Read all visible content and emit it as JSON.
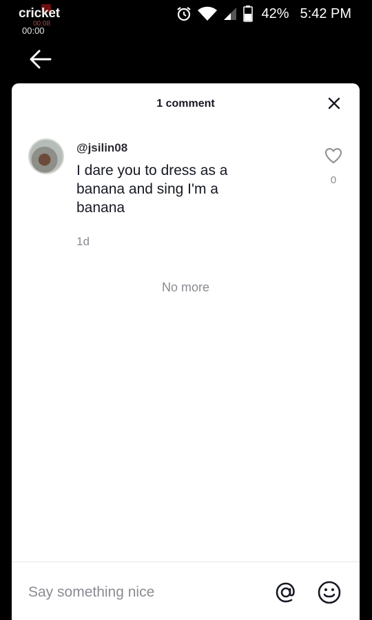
{
  "status_bar": {
    "carrier": "cricket",
    "rec_time": "00:00",
    "rec_time_sub": "00:08",
    "battery_percent": "42%",
    "clock": "5:42 PM",
    "icons": [
      "alarm-icon",
      "wifi-icon",
      "signal-icon",
      "battery-icon"
    ]
  },
  "nav": {
    "back_icon": "arrow-left-icon"
  },
  "sheet": {
    "title": "1 comment",
    "close_icon": "close-icon"
  },
  "comments": [
    {
      "username": "@jsilin08",
      "text": "I dare you to dress as a banana and sing I'm a banana",
      "time": "1d",
      "likes": "0",
      "like_icon": "heart-outline-icon"
    }
  ],
  "no_more_text": "No more",
  "composer": {
    "placeholder": "Say something nice",
    "mention_icon": "at-sign-icon",
    "emoji_icon": "emoji-smile-icon"
  },
  "colors": {
    "background": "#000000",
    "sheet": "#ffffff",
    "text_primary": "#161823",
    "text_secondary": "#8a8b91"
  }
}
